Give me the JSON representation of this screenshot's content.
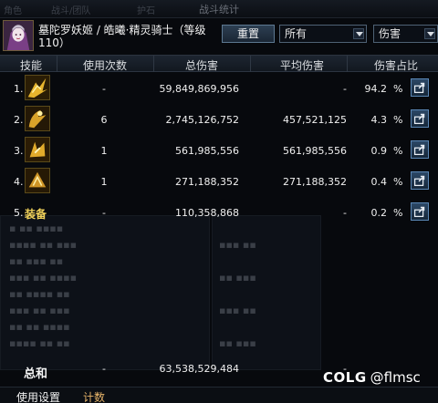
{
  "window": {
    "title": "战斗统计",
    "ghost_tabs": [
      "角色",
      "战斗/团队",
      "护石"
    ]
  },
  "header": {
    "avatar_icon": "character-portrait",
    "character_name": "墓陀罗妖姬 / 皓曦·精灵骑士（等级110）",
    "reset_label": "重置",
    "filter_select": "所有",
    "metric_select": "伤害"
  },
  "table": {
    "columns": [
      "技能",
      "使用次数",
      "总伤害",
      "平均伤害",
      "伤害占比"
    ],
    "rows": [
      {
        "index": "1.",
        "icon": "skill-icon-1",
        "count": "-",
        "total": "59,849,869,956",
        "avg": "-",
        "pct": "94.2",
        "unit": "%"
      },
      {
        "index": "2.",
        "icon": "skill-icon-2",
        "count": "6",
        "total": "2,745,126,752",
        "avg": "457,521,125",
        "pct": "4.3",
        "unit": "%"
      },
      {
        "index": "3.",
        "icon": "skill-icon-3",
        "count": "1",
        "total": "561,985,556",
        "avg": "561,985,556",
        "pct": "0.9",
        "unit": "%"
      },
      {
        "index": "4.",
        "icon": "skill-icon-4",
        "count": "1",
        "total": "271,188,352",
        "avg": "271,188,352",
        "pct": "0.4",
        "unit": "%"
      },
      {
        "index": "5.",
        "label": "装备",
        "count": "-",
        "total": "110,358,868",
        "avg": "-",
        "pct": "0.2",
        "unit": "%"
      }
    ],
    "total": {
      "label": "总和",
      "count": "-",
      "total": "63,538,529,484",
      "avg": "-"
    }
  },
  "footer": {
    "tab_settings": "使用设置",
    "tab_count": "计数"
  },
  "watermark": {
    "brand": "COLG",
    "handle": "@flmsc"
  },
  "colors": {
    "accent_gold": "#f2d35b",
    "tab_active": "#e8b56a",
    "button_blue": "#2c4866"
  }
}
